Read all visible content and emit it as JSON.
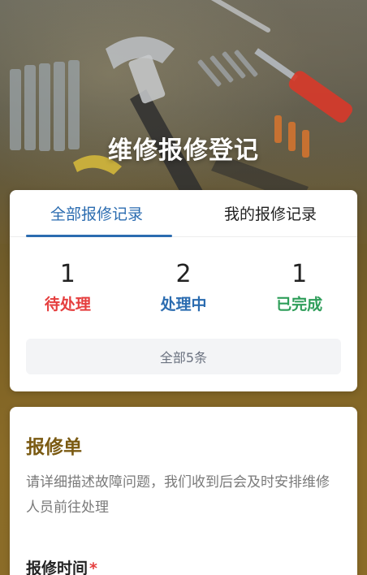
{
  "header": {
    "title": "维修报修登记"
  },
  "records": {
    "tabs": [
      {
        "label": "全部报修记录",
        "active": true
      },
      {
        "label": "我的报修记录",
        "active": false
      }
    ],
    "stats": [
      {
        "count": "1",
        "label": "待处理",
        "color": "#e53e3e"
      },
      {
        "count": "2",
        "label": "处理中",
        "color": "#2b6cb0"
      },
      {
        "count": "1",
        "label": "已完成",
        "color": "#2f9e5a"
      }
    ],
    "summary": "全部5条"
  },
  "form": {
    "title": "报修单",
    "description": "请详细描述故障问题，我们收到后会及时安排维修人员前往处理",
    "time_label": "报修时间",
    "required_mark": "*"
  },
  "colors": {
    "accent": "#2b6cb0",
    "form_title": "#7a5a12",
    "pending": "#e53e3e",
    "processing": "#2b6cb0",
    "done": "#2f9e5a"
  }
}
